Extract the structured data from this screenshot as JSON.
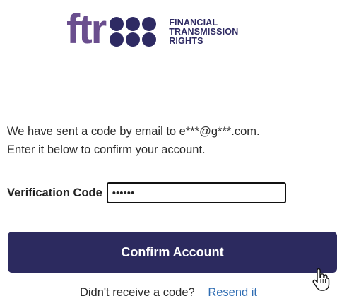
{
  "logo": {
    "wordmark": "ftr",
    "name_lines": [
      "FINANCIAL",
      "TRANSMISSION",
      "RIGHTS"
    ],
    "brand_color": "#6a4e8e",
    "dot_color": "#2e2a63"
  },
  "intro": {
    "line1": "We have sent a code by email to e***@g***.com.",
    "line2": "Enter it below to confirm your account."
  },
  "verification": {
    "label": "Verification Code",
    "value": "••••••"
  },
  "confirm_button": {
    "label": "Confirm Account",
    "color": "#2c2a5f"
  },
  "resend": {
    "prompt": "Didn't receive a code?",
    "link_label": "Resend it",
    "link_color": "#2f6db3"
  },
  "cursor": {
    "icon": "hand-pointer-icon"
  }
}
